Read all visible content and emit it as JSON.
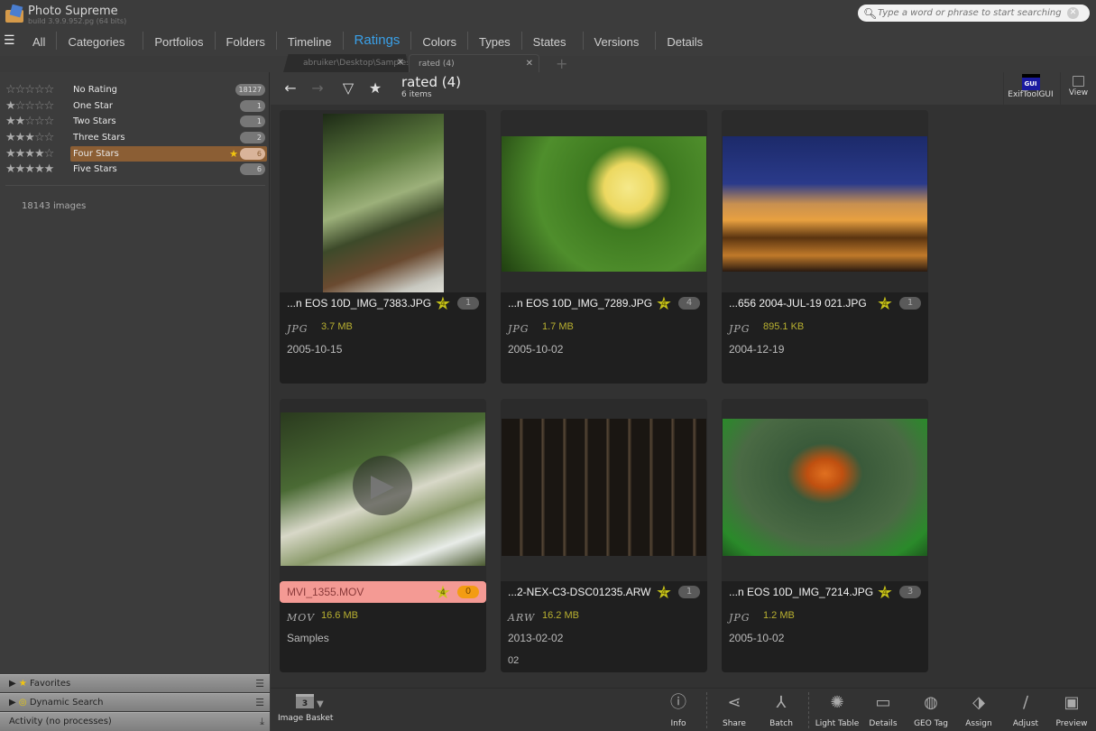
{
  "app": {
    "title": "Photo Supreme",
    "build": "build 3.9.9.952.pg (64 bits)"
  },
  "search": {
    "placeholder": "Type a word or phrase to start searching"
  },
  "nav": {
    "items": [
      "All",
      "Categories",
      "Portfolios",
      "Folders",
      "Timeline",
      "Ratings",
      "Colors",
      "Types",
      "States",
      "Versions",
      "Details"
    ],
    "active": "Ratings"
  },
  "tabs": [
    {
      "label": "abruiker\\Desktop\\Samples\\)"
    },
    {
      "label": "rated  (4)"
    }
  ],
  "ratings": [
    {
      "label": "No Rating",
      "stars": 0,
      "count": "18127"
    },
    {
      "label": "One Star",
      "stars": 1,
      "count": "1"
    },
    {
      "label": "Two Stars",
      "stars": 2,
      "count": "1"
    },
    {
      "label": "Three Stars",
      "stars": 3,
      "count": "2"
    },
    {
      "label": "Four Stars",
      "stars": 4,
      "count": "6",
      "selected": true
    },
    {
      "label": "Five Stars",
      "stars": 5,
      "count": "6"
    }
  ],
  "image_count": "18143 images",
  "panels": {
    "favorites": "Favorites",
    "dynamic_search": "Dynamic Search",
    "activity": "Activity (no processes)"
  },
  "toolbar": {
    "title": "rated  (4)",
    "subtitle": "6 items",
    "exif_label": "ExifToolGUI",
    "exif_icon_text": "GUI",
    "view_label": "View"
  },
  "cards": [
    {
      "name": "...n EOS 10D_IMG_7383.JPG",
      "rating": "4",
      "badge": "1",
      "type": "JPG",
      "size": "3.7 MB",
      "line1": "2005-10-15",
      "line2": ""
    },
    {
      "name": "...n EOS 10D_IMG_7289.JPG",
      "rating": "4",
      "badge": "4",
      "type": "JPG",
      "size": "1.7 MB",
      "line1": "2005-10-02",
      "line2": ""
    },
    {
      "name": "...656 2004-JUL-19 021.JPG",
      "rating": "4",
      "badge": "1",
      "type": "JPG",
      "size": "895.1 KB",
      "line1": "2004-12-19",
      "line2": ""
    },
    {
      "name": "MVI_1355.MOV",
      "rating": "4",
      "badge": "0",
      "type": "MOV",
      "size": "16.6 MB",
      "line1": "Samples",
      "line2": "",
      "highlight": true
    },
    {
      "name": "...2-NEX-C3-DSC01235.ARW",
      "rating": "4",
      "badge": "1",
      "type": "ARW",
      "size": "16.2 MB",
      "line1": "2013-02-02",
      "line2": "02"
    },
    {
      "name": "...n EOS 10D_IMG_7214.JPG",
      "rating": "4",
      "badge": "3",
      "type": "JPG",
      "size": "1.2 MB",
      "line1": "2005-10-02",
      "line2": ""
    }
  ],
  "bottom": {
    "basket_label": "Image Basket",
    "basket_count": "3",
    "buttons": [
      "Info",
      "Share",
      "Batch",
      "Light Table",
      "Details",
      "GEO Tag",
      "Assign",
      "Adjust",
      "Preview"
    ]
  }
}
